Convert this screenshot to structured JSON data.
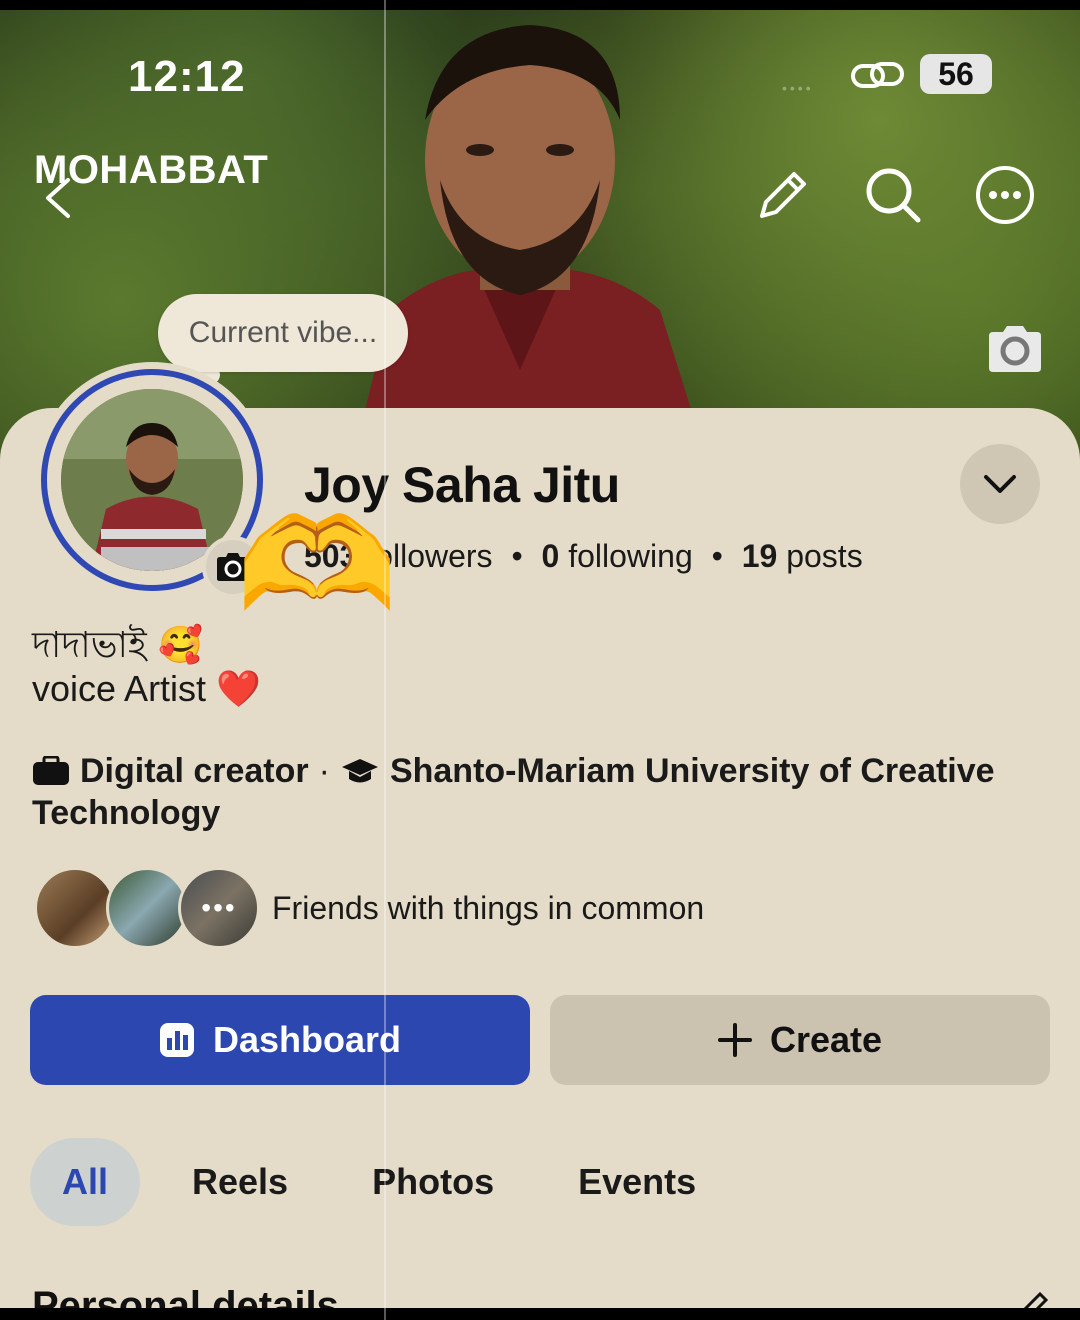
{
  "status_bar": {
    "time": "12:12",
    "battery": "56"
  },
  "header": {
    "title": "MOHABBAT",
    "icons": [
      "back-icon",
      "edit-icon",
      "search-icon",
      "more-icon",
      "camera-icon"
    ]
  },
  "vibe": {
    "placeholder": "Current vibe..."
  },
  "profile": {
    "name": "Joy Saha Jitu",
    "followers_count": "503",
    "followers_label": "followers",
    "following_count": "0",
    "following_label": "following",
    "posts_count": "19",
    "posts_label": "posts",
    "sticker": "🫶"
  },
  "bio": {
    "line1": "দাদাভাই 🥰",
    "line2": "voice Artist ❤️"
  },
  "details": {
    "category": "Digital creator",
    "education": "Shanto-Mariam University of Creative Technology"
  },
  "friends": {
    "text": "Friends with things in common",
    "more_glyph": "•••"
  },
  "actions": {
    "dashboard_label": "Dashboard",
    "create_label": "Create"
  },
  "tabs": [
    {
      "label": "All",
      "active": true
    },
    {
      "label": "Reels",
      "active": false
    },
    {
      "label": "Photos",
      "active": false
    },
    {
      "label": "Events",
      "active": false
    }
  ],
  "section": {
    "title": "Personal details"
  },
  "colors": {
    "accent": "#2c47b0",
    "sheet_bg": "#e4dcc8",
    "secondary_button": "#cbc2b0"
  }
}
